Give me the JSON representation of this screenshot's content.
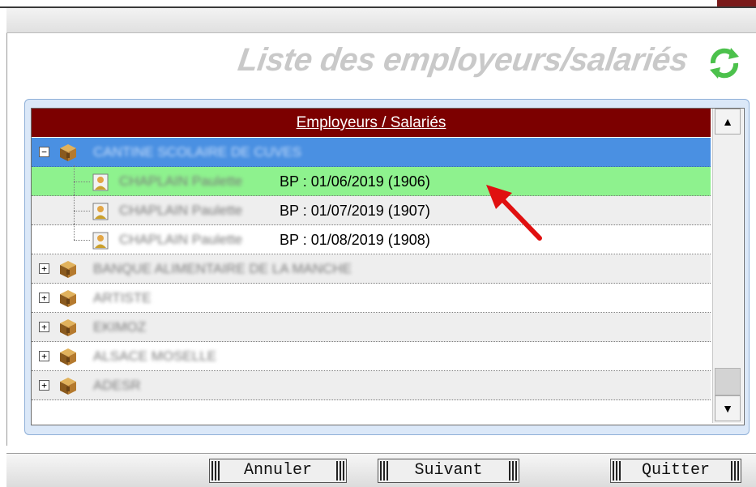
{
  "window": {
    "title": "Liste des employeurs/salariés",
    "refresh_icon": "refresh-arrows-icon"
  },
  "tree": {
    "header": "Employeurs / Salariés",
    "rows": [
      {
        "kind": "employer",
        "expanded": true,
        "name": "CANTINE SCOLAIRE DE CUVES",
        "selected": true,
        "icon": "building-box-icon"
      },
      {
        "kind": "employee",
        "name": "CHAPLAIN Paulette",
        "period": "BP : 01/06/2019 (1906)",
        "highlighted": true,
        "icon": "person-icon"
      },
      {
        "kind": "employee",
        "name": "CHAPLAIN Paulette",
        "period": "BP : 01/07/2019 (1907)",
        "icon": "person-icon"
      },
      {
        "kind": "employee",
        "name": "CHAPLAIN Paulette",
        "period": "BP : 01/08/2019 (1908)",
        "icon": "person-icon"
      },
      {
        "kind": "employer",
        "expanded": false,
        "name": "BANQUE ALIMENTAIRE DE LA MANCHE",
        "icon": "building-box-icon"
      },
      {
        "kind": "employer",
        "expanded": false,
        "name": "ARTISTE",
        "icon": "building-box-icon"
      },
      {
        "kind": "employer",
        "expanded": false,
        "name": "EKIMOZ",
        "icon": "building-box-icon"
      },
      {
        "kind": "employer",
        "expanded": false,
        "name": "ALSACE MOSELLE",
        "icon": "building-box-icon"
      },
      {
        "kind": "employer",
        "expanded": false,
        "name": "ADESR",
        "icon": "building-box-icon"
      }
    ],
    "expand_symbol": "+",
    "collapse_symbol": "−"
  },
  "annotation": {
    "icon": "red-arrow-icon",
    "color": "#e01010"
  },
  "colors": {
    "header_bg": "#7c0000",
    "selected_blue": "#4a90e2",
    "highlight_green": "#8ef28e"
  },
  "buttons": {
    "cancel": "Annuler",
    "next": "Suivant",
    "quit": "Quitter"
  }
}
